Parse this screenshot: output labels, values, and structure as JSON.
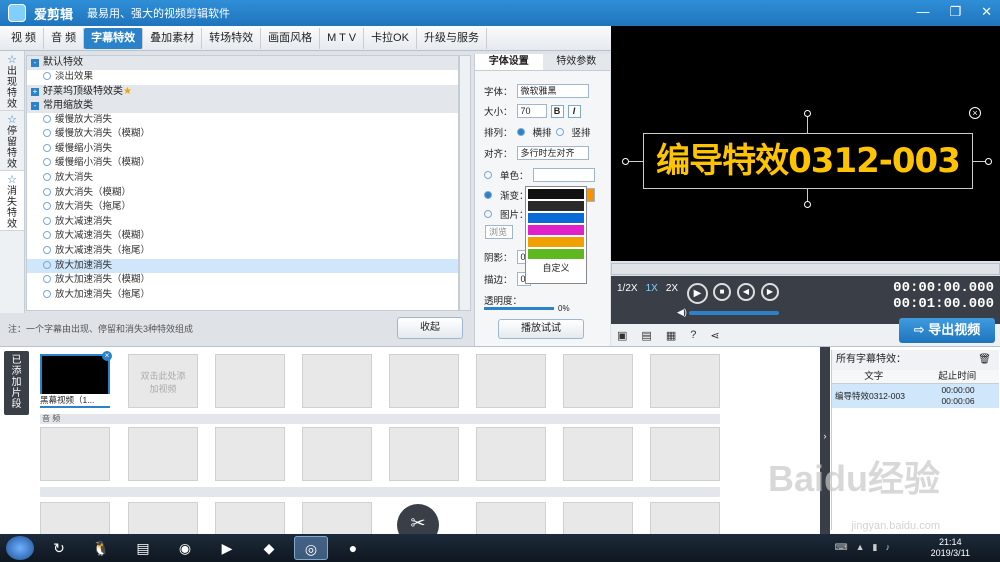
{
  "app": {
    "name": "爱剪辑",
    "slogan": "最易用、强大的视频剪辑软件"
  },
  "tabs": [
    "视 频",
    "音 频",
    "字幕特效",
    "叠加素材",
    "转场特效",
    "画面风格",
    "M T V",
    "卡拉OK",
    "升级与服务"
  ],
  "active_tab": "字幕特效",
  "vtabs": [
    "出现特效",
    "停留特效",
    "消失特效"
  ],
  "effects": {
    "categories": [
      {
        "label": "默认特效",
        "items": [
          "淡出效果"
        ]
      },
      {
        "label": "好莱坞顶级特效类",
        "items": []
      },
      {
        "label": "常用缩放类",
        "items": [
          "缓慢放大消失",
          "缓慢放大消失（模糊）",
          "缓慢缩小消失",
          "缓慢缩小消失（模糊）",
          "放大消失",
          "放大消失（模糊）",
          "放大消失（拖尾）",
          "放大减速消失",
          "放大减速消失（模糊）",
          "放大减速消失（拖尾）",
          "放大加速消失",
          "放大加速消失（模糊）",
          "放大加速消失（拖尾）"
        ]
      }
    ],
    "selected": "放大加速消失"
  },
  "note": "注：一个字幕由出现、停留和消失3种特效组成",
  "collapse_label": "收起",
  "settings": {
    "tab1": "字体设置",
    "tab2": "特效参数",
    "font_label": "字体：",
    "font_value": "微软雅黑",
    "size_label": "大小：",
    "size_value": "70",
    "arrange_label": "排列：",
    "arrange_h": "横排",
    "arrange_v": "竖排",
    "align_label": "对齐：",
    "align_value": "多行时左对齐",
    "single_label": "单色：",
    "gradient_label": "渐变：",
    "image_label": "图片：",
    "shadow_label": "阴影：",
    "shadow_value": "0",
    "stroke_label": "描边：",
    "stroke_value": "0",
    "opacity_label": "透明度：",
    "opacity_value": "0%",
    "browse_label": "浏览",
    "custom_label": "自定义",
    "play_test": "播放试试"
  },
  "palette_colors": [
    "#111111",
    "#2a2a2a",
    "#0a6ad6",
    "#e020c8",
    "#f0a000",
    "#60b820"
  ],
  "preview": {
    "title_text": "编导特效0312-003"
  },
  "player": {
    "speeds": [
      "1/2X",
      "1X",
      "2X"
    ],
    "time_current": "00:00:00.000",
    "time_total": "00:01:00.000"
  },
  "export_label": "导出视频",
  "timeline": {
    "label": "已添加片段",
    "clip_name": "黑幕视频（1...",
    "add_hint": "双击此处添加视频",
    "audio_label": "音 频"
  },
  "side_panel": {
    "title": "所有字幕特效：",
    "col_text": "文字",
    "col_time": "起止时间",
    "row_text": "编导特效0312-003",
    "row_start": "00:00:00",
    "row_end": "00:00:06"
  },
  "taskbar": {
    "time": "21:14",
    "date": "2019/3/11"
  },
  "watermark": {
    "text": "Baidu经验",
    "url": "jingyan.baidu.com"
  }
}
